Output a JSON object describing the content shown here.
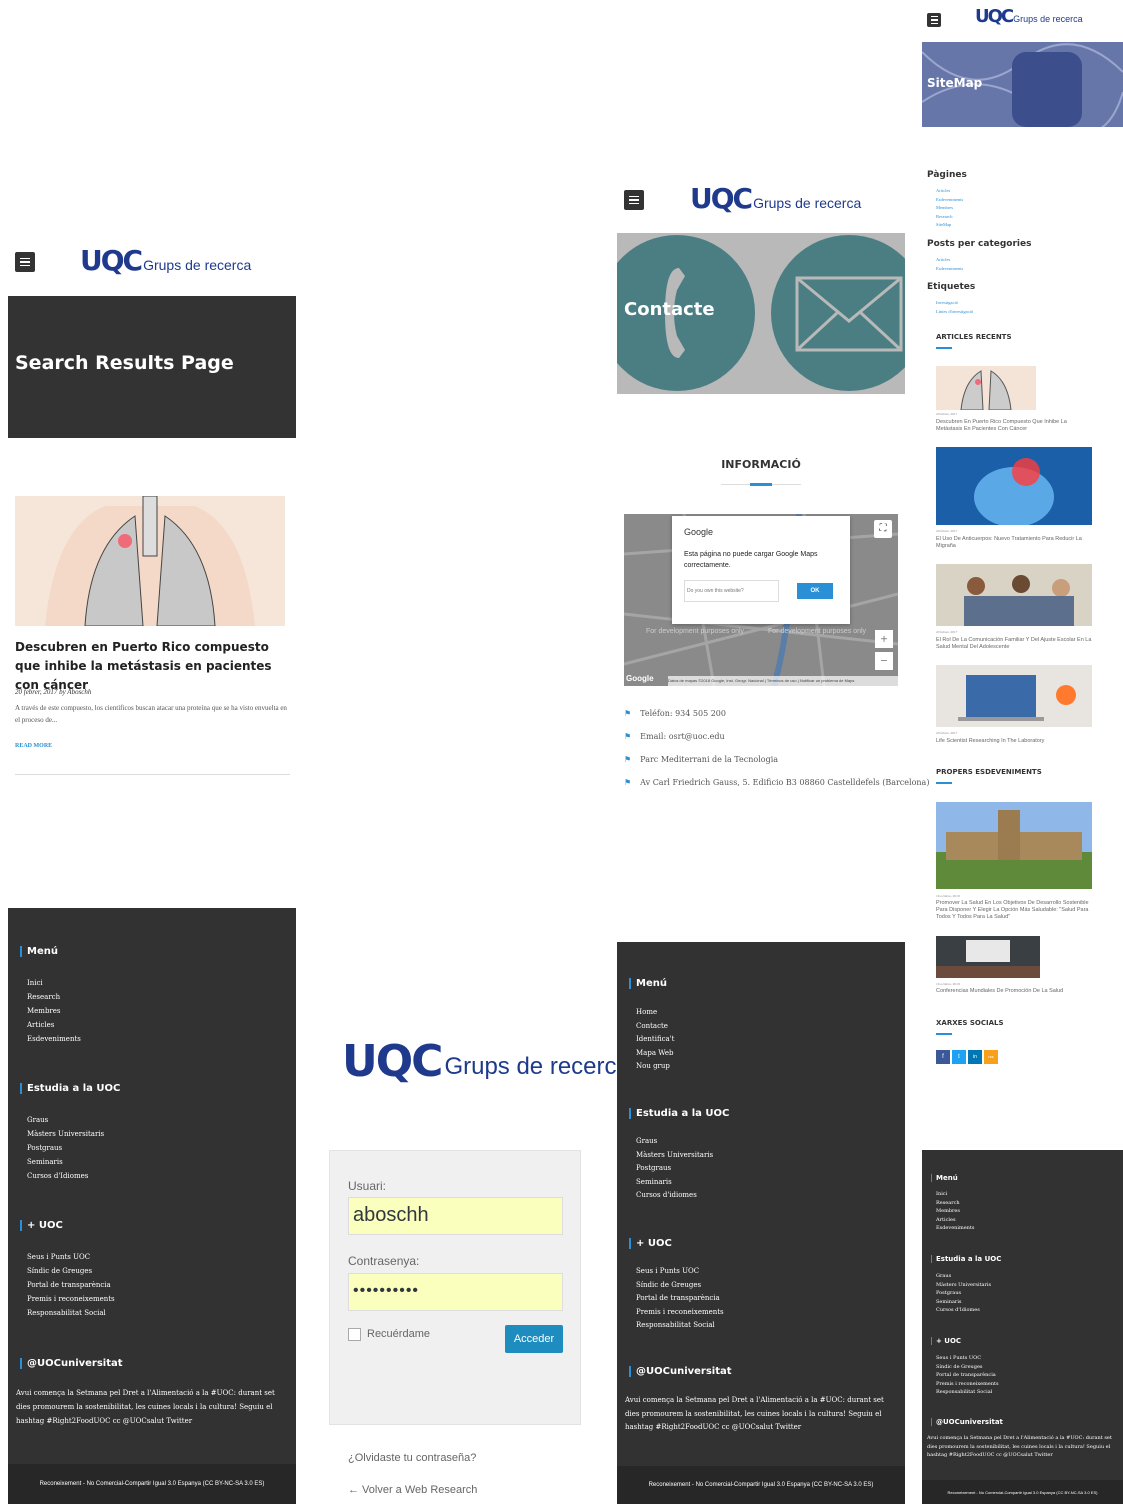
{
  "logo": {
    "u": "UQC",
    "text": "Grups de recerca"
  },
  "panel1": {
    "hero_title": "Search Results Page",
    "post_title": "Descubren en Puerto Rico compuesto que inhibe la metástasis en pacientes con cáncer",
    "post_meta": "20 febrer, 2017 by Aboschh",
    "post_excerpt": "A través de este compuesto, los científicos buscan atacar una proteína que se ha visto envuelta en el proceso de...",
    "read_more": "READ MORE"
  },
  "footer1": {
    "menu_title": "Menú",
    "menu": [
      "Inici",
      "Research",
      "Membres",
      "Articles",
      "Esdeveniments"
    ],
    "study_title": "Estudia a la UOC",
    "study": [
      "Graus",
      "Màsters Universitaris",
      "Postgraus",
      "Seminaris",
      "Cursos d'Idiomes"
    ],
    "plus_title": "+ UOC",
    "plus": [
      "Seus i Punts UOC",
      "Síndic de Greuges",
      "Portal de transparència",
      "Premis i reconeixements",
      "Responsabilitat Social"
    ],
    "twitter_title": "@UOCuniversitat",
    "tweet": "Avui comença la Setmana pel Dret a l'Alimentació a la #UOC: durant set dies promourem la sostenibilitat, les cuines locals i la cultura! Seguiu el hashtag #Right2FoodUOC cc @UOCsalut Twitter",
    "license": "Reconeixement - No Comercial-Compartir Igual 3.0 Espanya (CC BY-NC-SA 3.0 ES)"
  },
  "login": {
    "user_label": "Usuari:",
    "user_value": "aboschh",
    "pass_label": "Contrasenya:",
    "pass_value": "••••••••••",
    "remember": "Recuérdame",
    "submit": "Acceder",
    "lost": "¿Olvidaste tu contraseña?",
    "back": "← Volver a Web Research"
  },
  "contact": {
    "hero_title": "Contacte",
    "section_title": "INFORMACIÓ",
    "map_google": "Google",
    "map_error": "Esta página no puede cargar Google Maps correctamente.",
    "map_question": "Do you own this website?",
    "map_ok": "OK",
    "map_dev1": "For development purposes only",
    "map_dev2": "For development purposes only",
    "map_footer": "Datos de mapas ©2018 Google, Inst. Geogr. Nacional | Términos de uso | Notificar un problema de Maps",
    "info": [
      "Teléfon: 934 505 200",
      "Email: osrt@uoc.edu",
      "Parc Mediterrani de la Tecnologia",
      "Av Carl Friedrich Gauss, 5. Edificio B3 08860 Castelldefels (Barcelona)"
    ]
  },
  "footer2": {
    "menu_title": "Menú",
    "menu": [
      "Home",
      "Contacte",
      "Identifica't",
      "Mapa Web",
      "Nou grup"
    ],
    "study_title": "Estudia a la UOC",
    "study": [
      "Graus",
      "Màsters Universitaris",
      "Postgraus",
      "Seminaris",
      "Cursos d'idiomes"
    ],
    "plus_title": "+ UOC",
    "plus": [
      "Seus i Punts UOC",
      "Síndic de Greuges",
      "Portal de transparència",
      "Premis i reconeixements",
      "Responsabilitat Social"
    ],
    "twitter_title": "@UOCuniversitat",
    "tweet": "Avui comença la Setmana pel Dret a l'Alimentació a la #UOC: durant set dies promourem la sostenibilitat, les cuines locals i la cultura! Seguiu el hashtag #Right2FoodUOC cc @UOCsalut Twitter",
    "license": "Reconeixement - No Comercial-Compartir Igual 3.0 Espanya (CC BY-NC-SA 3.0 ES)"
  },
  "sitemap": {
    "hero_title": "SiteMap",
    "pages_title": "Pàgines",
    "pages": [
      "Articles",
      "Esdeveniments",
      "Membres",
      "Research",
      "SiteMap"
    ],
    "posts_title": "Posts per categories",
    "posts": [
      "Articles",
      "Esdeveniments"
    ],
    "tags_title": "Etiquetes",
    "tags": [
      "Investigació",
      "Línies d'investigació"
    ],
    "recent_title": "ARTICLES RECENTS",
    "recent": [
      {
        "date": "20 febrer, 2017",
        "title": "Descubren En Puerto Rico Compuesto Que Inhibe La Metástasis En Pacientes Con Cáncer"
      },
      {
        "date": "20 febrer, 2017",
        "title": "El Uso De Anticuerpos: Nuevo Tratamiento Para Reducir La Migraña"
      },
      {
        "date": "20 febrer, 2017",
        "title": "El Rol De La Comunicación Familiar Y Del Ajuste Escolar En La Salud Mental Del Adolescente"
      },
      {
        "date": "20 febrer, 2017",
        "title": "Life Scientist Researching In The Laboratory"
      }
    ],
    "events_title": "PROPERS ESDEVENIMENTS",
    "events": [
      {
        "date": "16 octubre, 2018",
        "title": "Promover La Salud En Los Objetivos De Desarrollo Sostenible Para Disponer Y Elegir La Opción Más Saludable: \"Salud Para Todos Y Todos Para La Salud\""
      },
      {
        "date": "16 octubre, 2018",
        "title": "Conferencias Mundiales De Promoción De La Salud"
      }
    ],
    "social_title": "XARXES SOCIALS",
    "social": [
      "f",
      "t",
      "in",
      "rss"
    ]
  },
  "footer3": {
    "menu_title": "Menú",
    "menu": [
      "Inici",
      "Research",
      "Membres",
      "Articles",
      "Esdeveniments"
    ],
    "study_title": "Estudia a la UOC",
    "study": [
      "Graus",
      "Màsters Universitaris",
      "Postgraus",
      "Seminaris",
      "Cursos d'Idiomes"
    ],
    "plus_title": "+ UOC",
    "plus": [
      "Seus i Punts UOC",
      "Síndic de Greuges",
      "Portal de transparència",
      "Premis i reconeixements",
      "Responsabilitat Social"
    ],
    "twitter_title": "@UOCuniversitat",
    "tweet": "Avui comença la Setmana pel Dret a l'Alimentació a la #UOC: durant set dies promourem la sostenibilitat, les cuines locals i la cultura! Seguiu el hashtag #Right2FoodUOC cc @UOCsalut Twitter",
    "license": "Reconeixement - No Comercial-Compartir Igual 3.0 Espanya (CC BY-NC-SA 3.0 ES)"
  },
  "colors": {
    "accent": "#2b8fd6",
    "dark": "#333333",
    "teal": "#4b7e83",
    "logo": "#1f3a8c"
  }
}
